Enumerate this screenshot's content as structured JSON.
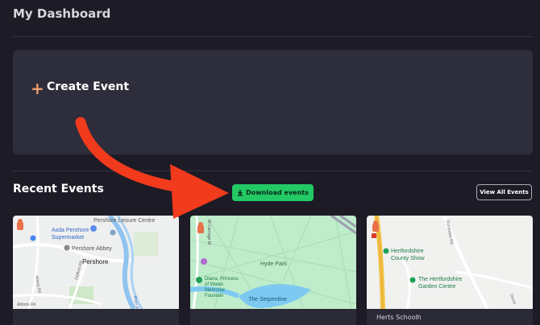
{
  "header": {
    "title": "My Dashboard"
  },
  "create_event": {
    "plus": "+",
    "label": "Create Event"
  },
  "recent_events": {
    "title": "Recent Events",
    "download_label": "Download events",
    "view_all_label": "View All Events"
  },
  "cards": [
    {
      "map_labels": {
        "poi1": "Pershore Leisure Centre",
        "poi2a": "Asda Pershore",
        "poi2b": "Supermarket",
        "poi3": "Pershore Abbey",
        "town": "Pershore",
        "road1": "Abbey Rd",
        "road2": "Defford Rd",
        "road3": "Abbots Rd",
        "river": "River Avon"
      },
      "footer": ""
    },
    {
      "map_labels": {
        "road1": "W Carriage Dr",
        "park": "Hyde Park",
        "memorial1": "Diana, Princess",
        "memorial2": "of Wales",
        "memorial3": "Memorial",
        "memorial4": "Fountain",
        "lake": "The Serpentine"
      },
      "footer": ""
    },
    {
      "map_labels": {
        "road1": "Dunstable Rd",
        "show1": "Hertfordshire",
        "show2": "County Show",
        "centre1": "The Hertfordshire",
        "centre2": "Garden Centre",
        "road2": "Dunst"
      },
      "footer": "Herts Schoolh"
    }
  ],
  "colors": {
    "background": "#1c1b26",
    "card": "#2e2d3b",
    "accent_green": "#23c965",
    "annotation_arrow": "#f23a1c"
  }
}
